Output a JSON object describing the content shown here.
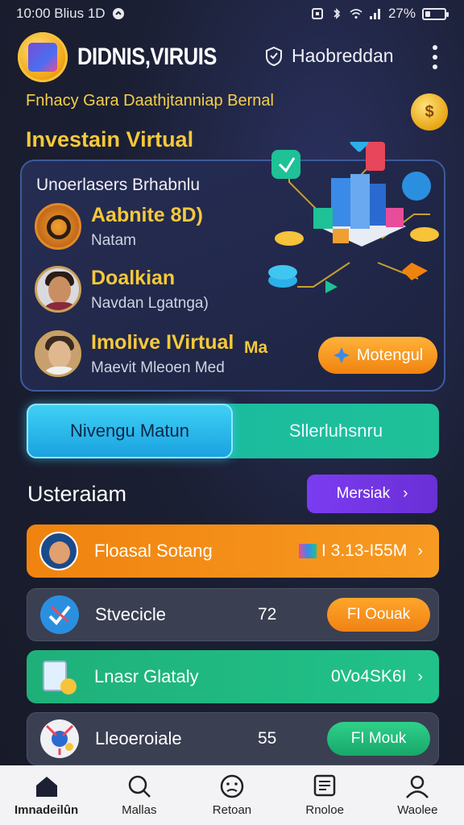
{
  "status_bar": {
    "time": "10:00 Blius 1D",
    "battery": "27%",
    "battery_level": 0.27
  },
  "header": {
    "brand": "DIDNIS,VIRUIS",
    "action_label": "Haobreddan"
  },
  "tagline": "Fnhacy Gara Daathjtanniap Bernal",
  "section_title": "Investain Virtual",
  "hero": {
    "subtitle": "Unoerlasers Brhabnlu",
    "people": [
      {
        "name": "Aabnite 8D)",
        "role": "Natam"
      },
      {
        "name": "Doalkian",
        "role": "Navdan Lgatnga)"
      },
      {
        "name": "Imolive IVirtual",
        "role": "Maevit Mleoen Med"
      }
    ],
    "extra_text": "Ma",
    "button_label": "Motengul"
  },
  "toggle": {
    "left": "Nivengu Matun",
    "right": "Sllerluhsnru",
    "active": "left"
  },
  "list": {
    "title": "Usteraiam",
    "title_button": "Mersiak",
    "items": [
      {
        "label": "Floasal Sotang",
        "value": "I 3.13-I55M",
        "color": "#f08a18"
      },
      {
        "label": "Stvecicle",
        "value": "72",
        "button": "FI Oouak",
        "color": "#3a3f52"
      },
      {
        "label": "Lnasr Glataly",
        "value": "0Vo4SK6I",
        "color": "#1fb07a"
      },
      {
        "label": "Lleoeroiale",
        "value": "55",
        "button": "FI Mouk",
        "color": "#3a3f52"
      }
    ]
  },
  "nav": [
    {
      "label": "Imnadeilûn",
      "icon": "home-icon"
    },
    {
      "label": "Mallas",
      "icon": "search-icon"
    },
    {
      "label": "Retoan",
      "icon": "face-icon"
    },
    {
      "label": "Rnoloe",
      "icon": "document-icon"
    },
    {
      "label": "Waolee",
      "icon": "profile-icon"
    }
  ]
}
